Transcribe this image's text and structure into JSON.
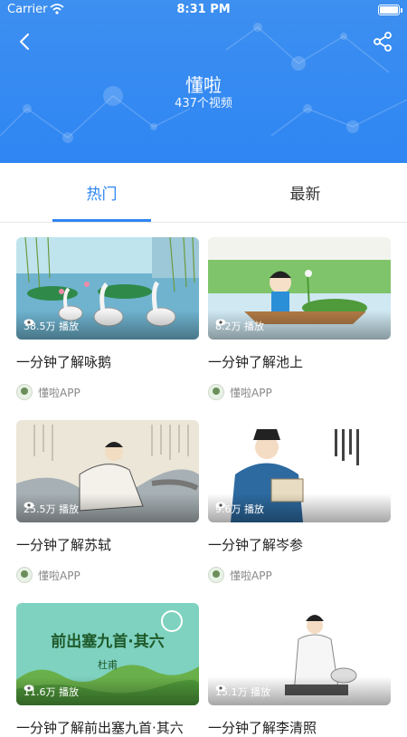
{
  "status_bar": {
    "carrier": "Carrier",
    "time": "8:31 PM"
  },
  "header": {
    "title": "懂啦",
    "subtitle": "437个视频"
  },
  "tabs": [
    {
      "label": "热门",
      "active": true
    },
    {
      "label": "最新",
      "active": false
    }
  ],
  "videos": [
    {
      "title": "一分钟了解咏鹅",
      "plays": "38.5万 播放",
      "author": "懂啦APP"
    },
    {
      "title": "一分钟了解池上",
      "plays": "8.2万 播放",
      "author": "懂啦APP"
    },
    {
      "title": "一分钟了解苏轼",
      "plays": "25.5万 播放",
      "author": "懂啦APP"
    },
    {
      "title": "一分钟了解岑参",
      "plays": "9.6万 播放",
      "author": "懂啦APP"
    },
    {
      "title": "一分钟了解前出塞九首·其六",
      "plays": "11.6万 播放",
      "author": "懂啦APP",
      "thumb_text": "前出塞九首·其六",
      "thumb_subtext": "杜甫"
    },
    {
      "title": "一分钟了解李清照",
      "plays": "15.1万 播放",
      "author": "懂啦APP"
    }
  ],
  "colors": {
    "accent": "#2f86f3",
    "header_bg": "#3d8ff0"
  }
}
